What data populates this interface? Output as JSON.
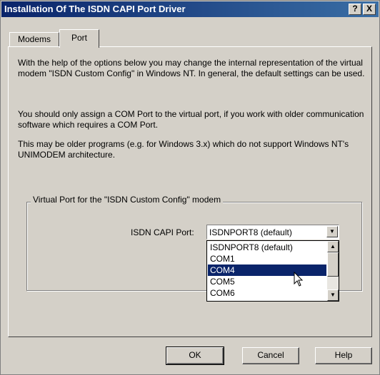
{
  "window": {
    "title": "Installation Of The ISDN CAPI Port Driver",
    "help_button": "?",
    "close_button": "X"
  },
  "tabs": [
    {
      "label": "Modems",
      "active": false
    },
    {
      "label": "Port",
      "active": true
    }
  ],
  "content": {
    "paragraph1": "With the help of the options below you may change the internal representation of the virtual modem \"ISDN Custom Config\" in Windows NT. In general, the default settings can be used.",
    "paragraph2": "You should only assign a COM Port to the virtual port, if you work with older communication software which requires a COM Port.",
    "paragraph3": "This may be older programs (e.g. for Windows 3.x) which do not support Windows NT's UNIMODEM architecture."
  },
  "group": {
    "label": "Virtual Port for the \"ISDN Custom Config\" modem",
    "field_label": "ISDN CAPI Port:",
    "selected_value": "ISDNPORT8 (default)",
    "options": [
      "ISDNPORT8 (default)",
      "COM1",
      "COM4",
      "COM5",
      "COM6"
    ],
    "highlighted_option": "COM4"
  },
  "buttons": {
    "ok": "OK",
    "cancel": "Cancel",
    "help": "Help"
  },
  "colors": {
    "titlebar": "#0a246a",
    "selection": "#0a246a",
    "face": "#d4d0c8"
  }
}
